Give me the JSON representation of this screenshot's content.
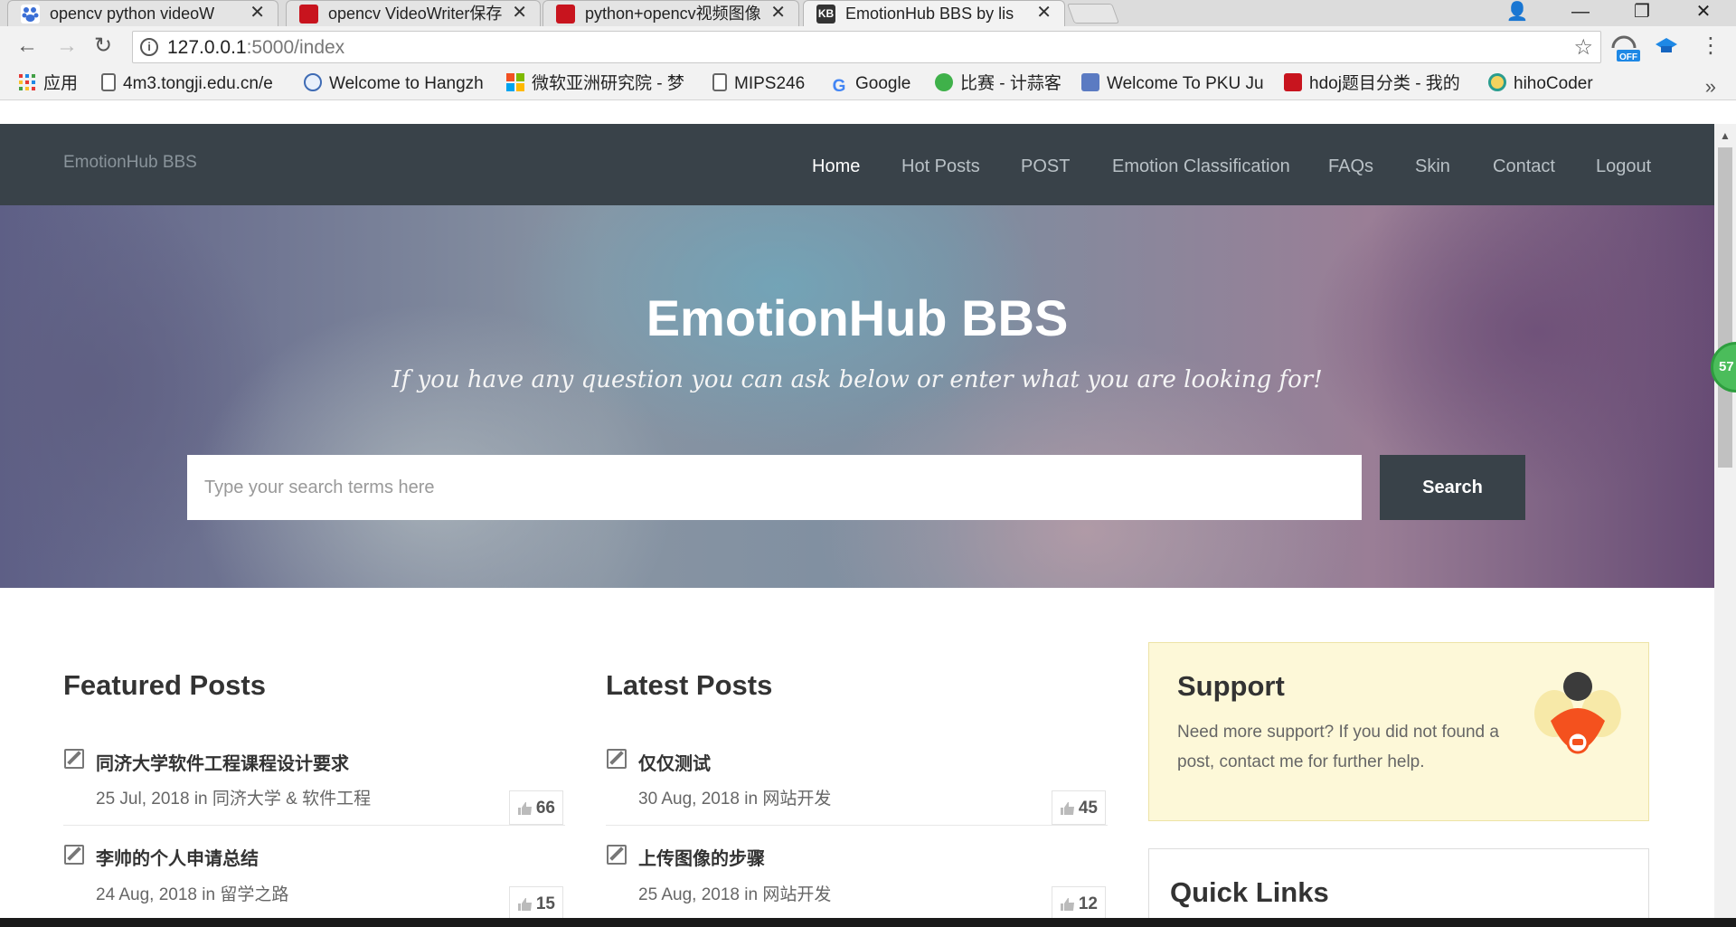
{
  "browser": {
    "tabs": [
      {
        "title": "opencv python videoW",
        "favicon_color": "#3b6fd6"
      },
      {
        "title": "opencv VideoWriter保存",
        "favicon_color": "#c8141e"
      },
      {
        "title": "python+opencv视频图像",
        "favicon_color": "#c8141e"
      },
      {
        "title": "EmotionHub BBS by lis",
        "favicon_color": "#333333",
        "favicon_text": "KB",
        "active": true
      }
    ],
    "window_controls": {
      "profile": "👤",
      "minimize": "—",
      "maximize": "❐",
      "close": "✕"
    },
    "url_host": "127.0.0.1",
    "url_path": ":5000/index",
    "bookmarks": [
      {
        "label": "应用",
        "icon": "apps-icon"
      },
      {
        "label": "4m3.tongji.edu.cn/e",
        "icon": "page-icon"
      },
      {
        "label": "Welcome to Hangzh",
        "icon": "globe-icon"
      },
      {
        "label": "微软亚洲研究院 - 梦",
        "icon": "microsoft-icon"
      },
      {
        "label": "MIPS246",
        "icon": "page-icon"
      },
      {
        "label": "Google",
        "icon": "google-icon"
      },
      {
        "label": "比赛 - 计蒜客",
        "icon": "jisuanke-icon"
      },
      {
        "label": "Welcome To PKU Ju",
        "icon": "poj-icon"
      },
      {
        "label": "hdoj题目分类 - 我的",
        "icon": "csdn-icon"
      },
      {
        "label": "hihoCoder",
        "icon": "hihocoder-icon"
      }
    ],
    "extension_badge": "OFF"
  },
  "site": {
    "brand": "EmotionHub BBS",
    "nav": [
      "Home",
      "Hot Posts",
      "POST",
      "Emotion Classification",
      "FAQs",
      "Skin",
      "Contact",
      "Logout"
    ]
  },
  "hero": {
    "title": "EmotionHub BBS",
    "subtitle": "If you have any question you can ask below or enter what you are looking for!",
    "search_placeholder": "Type your search terms here",
    "search_button": "Search"
  },
  "featured": {
    "title": "Featured Posts",
    "posts": [
      {
        "title": "同济大学软件工程课程设计要求",
        "date": "25 Jul, 2018",
        "in": "in",
        "category": "同济大学 & 软件工程",
        "likes": "66"
      },
      {
        "title": "李帅的个人申请总结",
        "date": "24 Aug, 2018",
        "in": "in",
        "category": "留学之路",
        "likes": "15"
      }
    ]
  },
  "latest": {
    "title": "Latest Posts",
    "posts": [
      {
        "title": "仅仅测试",
        "date": "30 Aug, 2018",
        "in": "in",
        "category": "网站开发",
        "likes": "45"
      },
      {
        "title": "上传图像的步骤",
        "date": "25 Aug, 2018",
        "in": "in",
        "category": "网站开发",
        "likes": "12"
      }
    ]
  },
  "support": {
    "title": "Support",
    "text": "Need more support? If you did not found a post, contact me for further help."
  },
  "quick_links": {
    "title": "Quick Links"
  },
  "floating_badge": "57"
}
